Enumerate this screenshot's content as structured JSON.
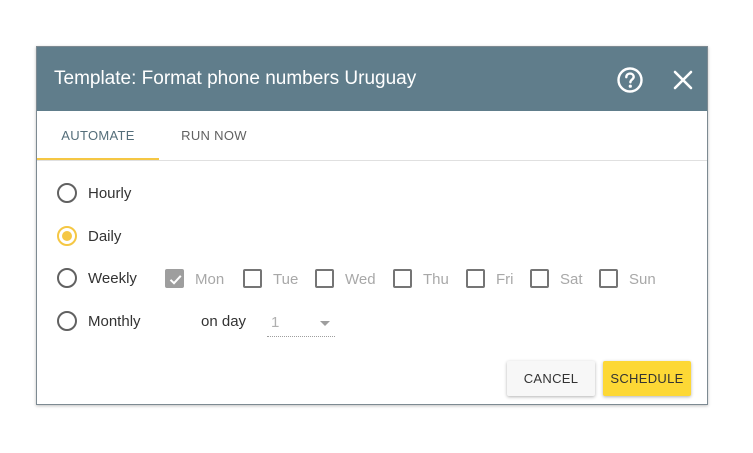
{
  "dialog": {
    "title": "Template: Format phone numbers Uruguay",
    "help_icon": "help-circle-icon",
    "close_icon": "close-icon"
  },
  "tabs": [
    {
      "label": "AUTOMATE",
      "active": true
    },
    {
      "label": "RUN NOW",
      "active": false
    }
  ],
  "schedule": {
    "options": [
      {
        "label": "Hourly",
        "selected": false
      },
      {
        "label": "Daily",
        "selected": true
      },
      {
        "label": "Weekly",
        "selected": false
      },
      {
        "label": "Monthly",
        "selected": false
      }
    ],
    "weekdays": [
      {
        "label": "Mon",
        "checked": true
      },
      {
        "label": "Tue",
        "checked": false
      },
      {
        "label": "Wed",
        "checked": false
      },
      {
        "label": "Thu",
        "checked": false
      },
      {
        "label": "Fri",
        "checked": false
      },
      {
        "label": "Sat",
        "checked": false
      },
      {
        "label": "Sun",
        "checked": false
      }
    ],
    "on_day_label": "on day",
    "day_value": "1"
  },
  "buttons": {
    "cancel": "CANCEL",
    "schedule": "SCHEDULE"
  },
  "colors": {
    "header": "#607d8b",
    "accent": "#f5c744",
    "schedule_button": "#fdd835"
  }
}
